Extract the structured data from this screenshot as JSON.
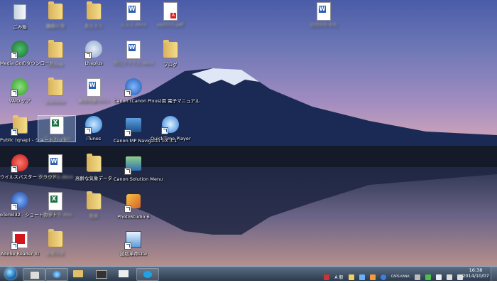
{
  "desktop": {
    "icons": [
      {
        "label": "ごみ箱",
        "blur": false
      },
      {
        "label": "職務の流",
        "blur": true
      },
      {
        "label": "見えカス",
        "blur": true
      },
      {
        "label": "ふふふ.docx",
        "blur": true
      },
      {
        "label": "ea2015.pdf",
        "blur": true
      },
      {
        "label": "日付のわすれ",
        "blur": true
      },
      {
        "label": "Media Goのダウンロード",
        "blur": false
      },
      {
        "label": "Ddflow",
        "blur": true
      },
      {
        "label": "Lhaplus",
        "blur": false
      },
      {
        "label": "同じファイル.docx",
        "blur": true
      },
      {
        "label": "ブログ",
        "blur": false
      },
      {
        "label": "VAIO ケア",
        "blur": false
      },
      {
        "label": "elafolder",
        "blur": true
      },
      {
        "label": "練習問題.docx",
        "blur": true
      },
      {
        "label": "Canon (Canon Pixus)用 電子マニュアル",
        "blur": false
      },
      {
        "label": "Public (qnap) - ショートカット",
        "blur": false
      },
      {
        "label": "ブック1.xlsx",
        "blur": true
      },
      {
        "label": "iTunes",
        "blur": false
      },
      {
        "label": "Canon MP Navigator EX 3.1",
        "blur": false
      },
      {
        "label": "QuickTime Player",
        "blur": false
      },
      {
        "label": "ウイルスバスター クラウド",
        "blur": false
      },
      {
        "label": "マニュアル.docx",
        "blur": true
      },
      {
        "label": "高齢な気象データ",
        "blur": false
      },
      {
        "label": "Canon Solution Menu",
        "blur": false
      },
      {
        "label": "oTenki32 - ショートカット",
        "blur": false
      },
      {
        "label": "一般表です.xlsx",
        "blur": true
      },
      {
        "label": "見本",
        "blur": true
      },
      {
        "label": "PhotoStudio 6",
        "blur": false
      },
      {
        "label": "Adobe Reader XI",
        "blur": false
      },
      {
        "label": "お知らせ",
        "blur": true
      },
      {
        "label": "読取革命Lite",
        "blur": false
      }
    ]
  },
  "taskbar": {
    "tray_text": "A 般",
    "caps": "CAPS KANA",
    "clock_time": "16:38",
    "clock_date": "2014/10/07"
  }
}
